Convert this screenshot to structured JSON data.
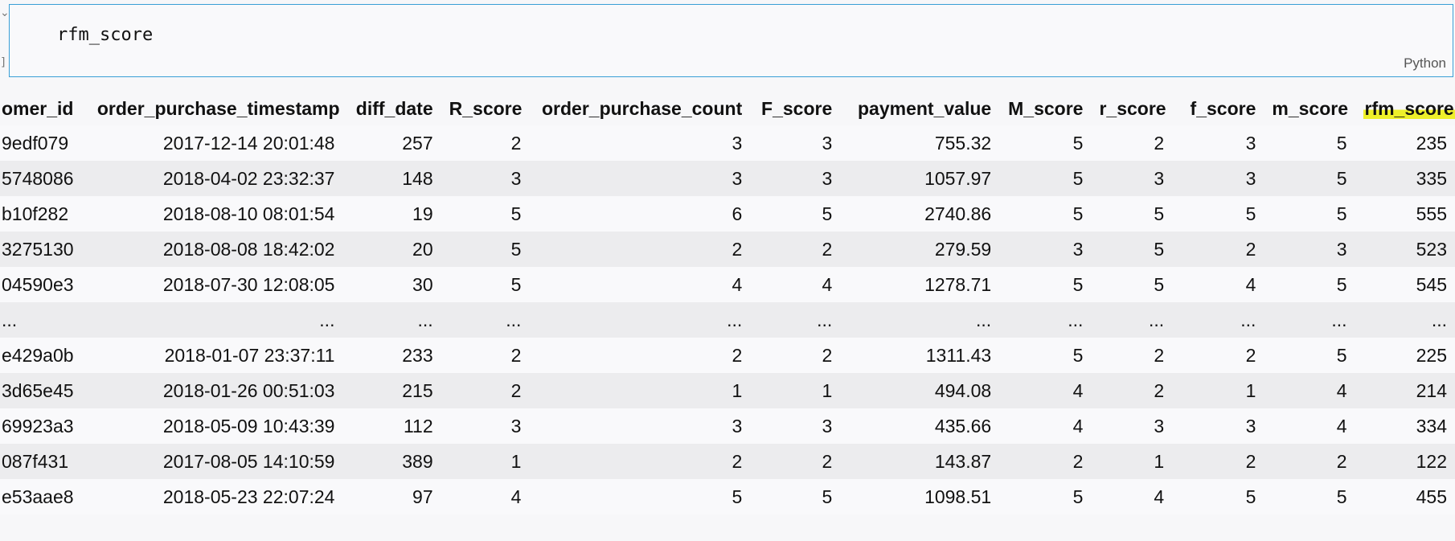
{
  "cell": {
    "code": "rfm_score",
    "language": "Python"
  },
  "table": {
    "columns": [
      "omer_id",
      "order_purchase_timestamp",
      "diff_date",
      "R_score",
      "order_purchase_count",
      "F_score",
      "payment_value",
      "M_score",
      "r_score",
      "f_score",
      "m_score",
      "rfm_score"
    ],
    "highlighted_column": "rfm_score",
    "highlight_color": "#eef02a",
    "rows": [
      [
        "9edf079",
        "2017-12-14 20:01:48",
        "257",
        "2",
        "3",
        "3",
        "755.32",
        "5",
        "2",
        "3",
        "5",
        "235"
      ],
      [
        "5748086",
        "2018-04-02 23:32:37",
        "148",
        "3",
        "3",
        "3",
        "1057.97",
        "5",
        "3",
        "3",
        "5",
        "335"
      ],
      [
        "b10f282",
        "2018-08-10 08:01:54",
        "19",
        "5",
        "6",
        "5",
        "2740.86",
        "5",
        "5",
        "5",
        "5",
        "555"
      ],
      [
        "3275130",
        "2018-08-08 18:42:02",
        "20",
        "5",
        "2",
        "2",
        "279.59",
        "3",
        "5",
        "2",
        "3",
        "523"
      ],
      [
        "04590e3",
        "2018-07-30 12:08:05",
        "30",
        "5",
        "4",
        "4",
        "1278.71",
        "5",
        "5",
        "4",
        "5",
        "545"
      ],
      [
        "...",
        "...",
        "...",
        "...",
        "...",
        "...",
        "...",
        "...",
        "...",
        "...",
        "...",
        "..."
      ],
      [
        "e429a0b",
        "2018-01-07 23:37:11",
        "233",
        "2",
        "2",
        "2",
        "1311.43",
        "5",
        "2",
        "2",
        "5",
        "225"
      ],
      [
        "3d65e45",
        "2018-01-26 00:51:03",
        "215",
        "2",
        "1",
        "1",
        "494.08",
        "4",
        "2",
        "1",
        "4",
        "214"
      ],
      [
        "69923a3",
        "2018-05-09 10:43:39",
        "112",
        "3",
        "3",
        "3",
        "435.66",
        "4",
        "3",
        "3",
        "4",
        "334"
      ],
      [
        "087f431",
        "2017-08-05 14:10:59",
        "389",
        "1",
        "2",
        "2",
        "143.87",
        "2",
        "1",
        "2",
        "2",
        "122"
      ],
      [
        "e53aae8",
        "2018-05-23 22:07:24",
        "97",
        "4",
        "5",
        "5",
        "1098.51",
        "5",
        "4",
        "5",
        "5",
        "455"
      ]
    ]
  }
}
